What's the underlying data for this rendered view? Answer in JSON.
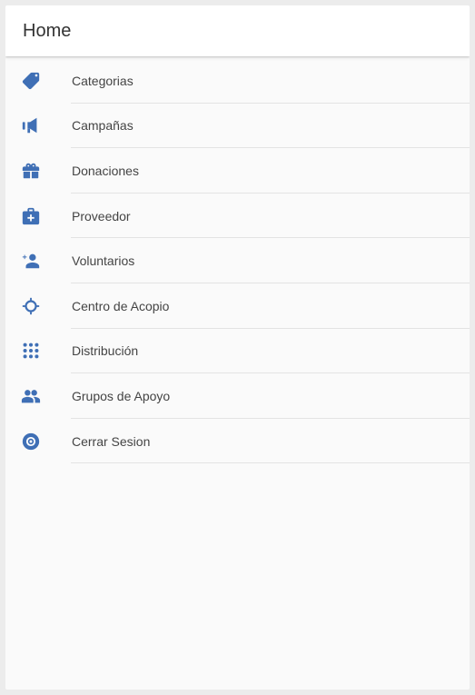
{
  "appbar": {
    "title": "Home"
  },
  "accent_color": "#3f6fb5",
  "menu": {
    "items": [
      {
        "label": "Categorias",
        "icon": "tag-icon"
      },
      {
        "label": "Campañas",
        "icon": "megaphone-icon"
      },
      {
        "label": "Donaciones",
        "icon": "gift-icon"
      },
      {
        "label": "Proveedor",
        "icon": "medical-bag-icon"
      },
      {
        "label": "Voluntarios",
        "icon": "person-add-icon"
      },
      {
        "label": "Centro de Acopio",
        "icon": "crosshair-icon"
      },
      {
        "label": "Distribución",
        "icon": "apps-grid-icon"
      },
      {
        "label": "Grupos de Apoyo",
        "icon": "people-icon"
      },
      {
        "label": "Cerrar Sesion",
        "icon": "logout-circle-icon"
      }
    ]
  }
}
